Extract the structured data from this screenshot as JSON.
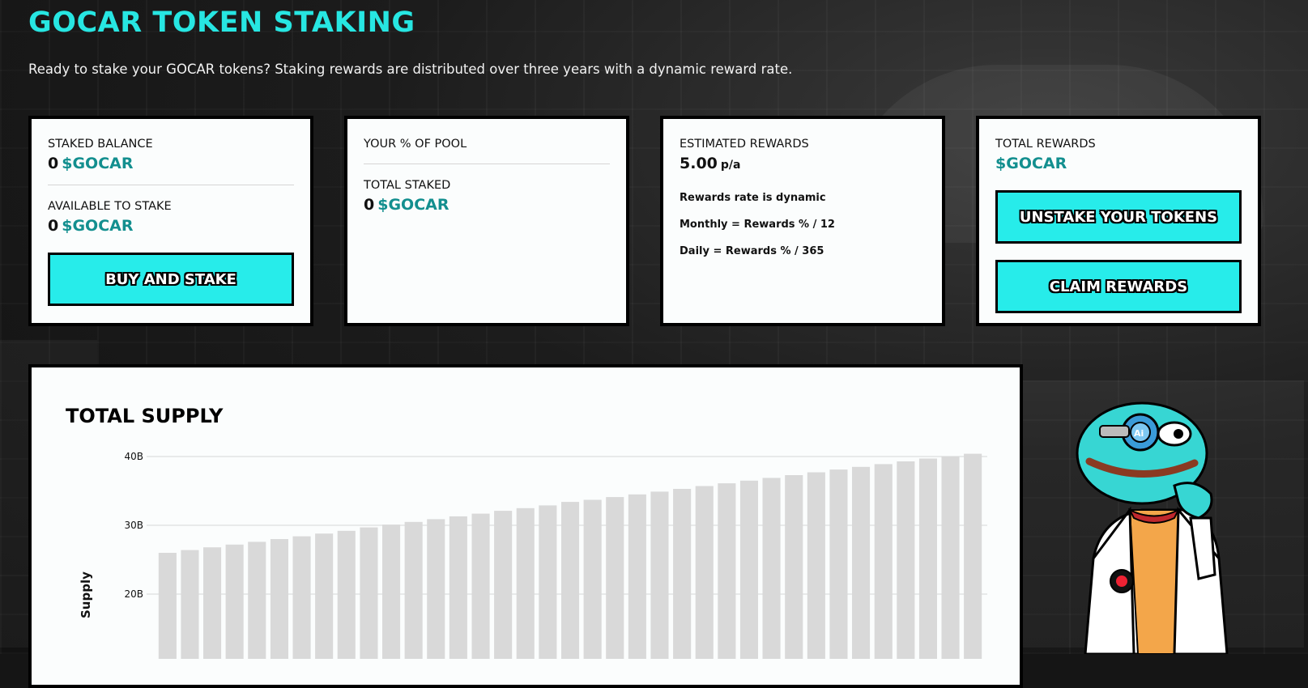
{
  "header": {
    "title": "GOCAR TOKEN STAKING",
    "subtitle": "Ready to stake your GOCAR tokens? Staking rewards are distributed over three years with a dynamic reward rate."
  },
  "cards": {
    "staked_balance": {
      "label": "STAKED BALANCE",
      "amount": "0",
      "token": "$GOCAR"
    },
    "available": {
      "label": "AVAILABLE TO STAKE",
      "amount": "0",
      "token": "$GOCAR"
    },
    "buy_button": "BUY AND STAKE",
    "pool": {
      "label": "YOUR % OF POOL"
    },
    "total_staked": {
      "label": "TOTAL STAKED",
      "amount": "0",
      "token": "$GOCAR"
    },
    "estimated": {
      "label": "ESTIMATED REWARDS",
      "amount": "5.00",
      "unit": "p/a",
      "note1": "Rewards rate is dynamic",
      "note2": "Monthly = Rewards % / 12",
      "note3": "Daily = Rewards % / 365"
    },
    "total_rewards": {
      "label": "TOTAL REWARDS",
      "token": "$GOCAR"
    },
    "unstake_button": "UNSTAKE YOUR TOKENS",
    "claim_button": "CLAIM REWARDS"
  },
  "colors": {
    "accent": "#27e6e2",
    "token": "#138f8f",
    "bar": "#d9d9d9"
  },
  "chart_data": {
    "type": "bar",
    "title": "TOTAL SUPPLY",
    "ylabel": "Supply",
    "xlabel": "",
    "ylim": [
      10,
      42
    ],
    "y_ticks": [
      "40B",
      "30B",
      "20B"
    ],
    "y_tick_values": [
      40,
      30,
      20
    ],
    "grid": true,
    "values": [
      26.0,
      26.4,
      26.8,
      27.2,
      27.6,
      28.0,
      28.4,
      28.8,
      29.2,
      29.7,
      30.1,
      30.5,
      30.9,
      31.3,
      31.7,
      32.1,
      32.5,
      32.9,
      33.4,
      33.7,
      34.1,
      34.5,
      34.9,
      35.3,
      35.7,
      36.1,
      36.5,
      36.9,
      37.3,
      37.7,
      38.1,
      38.5,
      38.9,
      39.3,
      39.7,
      40.0,
      40.4
    ]
  }
}
